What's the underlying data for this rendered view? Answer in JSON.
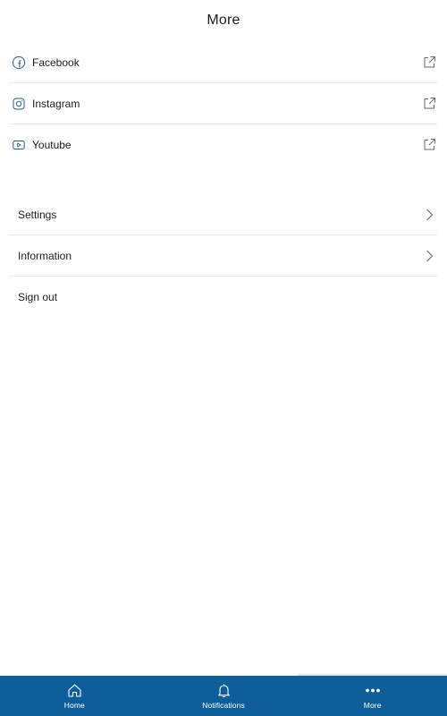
{
  "header": {
    "title": "More"
  },
  "social": {
    "items": [
      {
        "label": "Facebook",
        "icon": "facebook-icon"
      },
      {
        "label": "Instagram",
        "icon": "instagram-icon"
      },
      {
        "label": "Youtube",
        "icon": "youtube-icon"
      }
    ]
  },
  "menu": {
    "items": [
      {
        "label": "Settings"
      },
      {
        "label": "Information"
      },
      {
        "label": "Sign out"
      }
    ]
  },
  "tabbar": {
    "active": "More",
    "tabs": [
      {
        "label": "Home",
        "icon": "home-icon"
      },
      {
        "label": "Notifications",
        "icon": "bell-icon"
      },
      {
        "label": "More",
        "icon": "more-dots-icon"
      }
    ]
  },
  "colors": {
    "brand": "#0d5e99",
    "icon_accent": "#1f5f8f",
    "divider": "#e8e8e8",
    "text": "#1b1b1b"
  }
}
